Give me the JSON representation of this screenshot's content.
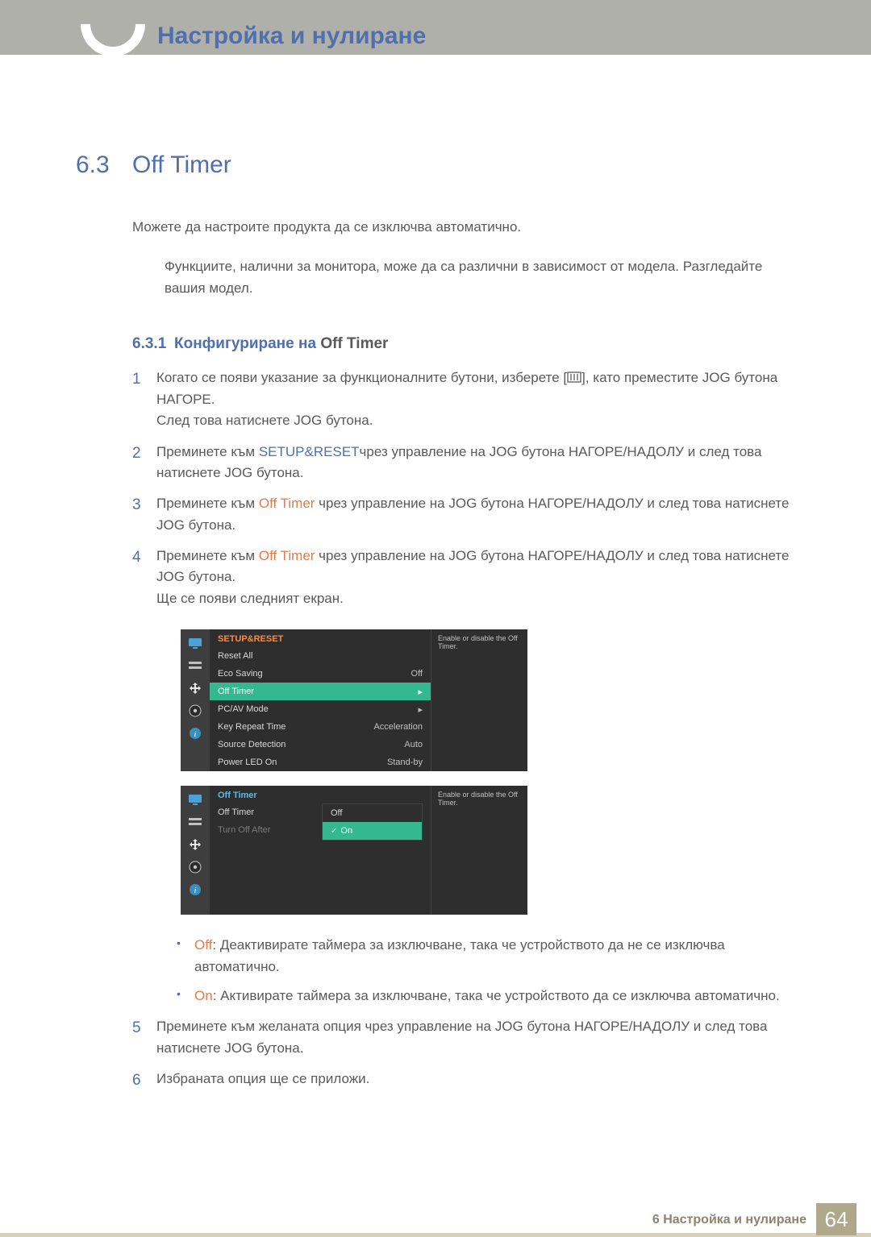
{
  "header": {
    "chapter_title": "Настройка и нулиране"
  },
  "section": {
    "number": "6.3",
    "title": "Off Timer"
  },
  "intro": "Можете да настроите продукта да се изключва автоматично.",
  "note": "Функциите, налични за монитора, може да са различни в зависимост от модела. Разгледайте вашия модел.",
  "subsection": {
    "number": "6.3.1",
    "prefix": "Конфигуриране на ",
    "suffix": "Off Timer"
  },
  "steps": {
    "s1a": "Когато се появи указание за функционалните бутони, изберете [",
    "s1b": "], като преместите ",
    "s1_jog": "JOG",
    "s1c": " бутона НАГОРЕ.",
    "s1d": "След това натиснете ",
    "s1e": " бутона.",
    "s2a": "Преминете към ",
    "s2_setup": "SETUP&RESET",
    "s2b": "чрез управление на ",
    "s2c": " бутона НАГОРЕ/НАДОЛУ и след това натиснете ",
    "s3a": "Преминете към ",
    "s3_off": "Off Timer",
    "s3b": " чрез управление на ",
    "s3c": " бутона НАГОРЕ/НАДОЛУ и след това натиснете ",
    "s4a": "Преминете към ",
    "s4b": " чрез управление на ",
    "s4c": " бутона НАГОРЕ/НАДОЛУ и след това натиснете ",
    "s4d": "Ще се появи следният екран.",
    "s5a": "Преминете към желаната опция чрез управление на ",
    "s5b": " бутона НАГОРЕ/НАДОЛУ и след това натиснете ",
    "s6": "Избраната опция ще се приложи."
  },
  "bullets": {
    "off_label": "Off",
    "off_text": ": Деактивирате таймера за изключване, така че устройството да не се изключва автоматично.",
    "on_label": "On",
    "on_text": ": Активирате таймера за изключване, така че устройството да се изключва автоматично."
  },
  "osd1": {
    "title": "SETUP&RESET",
    "tip": "Enable or disable the Off Timer.",
    "rows": [
      {
        "label": "Reset All",
        "value": ""
      },
      {
        "label": "Eco Saving",
        "value": "Off"
      },
      {
        "label": "Off Timer",
        "value": "▸",
        "active": true
      },
      {
        "label": "PC/AV Mode",
        "value": "▸"
      },
      {
        "label": "Key Repeat Time",
        "value": "Acceleration"
      },
      {
        "label": "Source Detection",
        "value": "Auto"
      },
      {
        "label": "Power LED On",
        "value": "Stand-by"
      }
    ]
  },
  "osd2": {
    "title": "Off Timer",
    "tip": "Enable or disable the Off Timer.",
    "labels": [
      {
        "text": "Off Timer",
        "dim": false
      },
      {
        "text": "Turn Off After",
        "dim": true
      }
    ],
    "options": [
      {
        "text": "Off",
        "active": false
      },
      {
        "text": "On",
        "active": true
      }
    ]
  },
  "footer": {
    "text": "6 Настройка и нулиране",
    "page": "64"
  }
}
